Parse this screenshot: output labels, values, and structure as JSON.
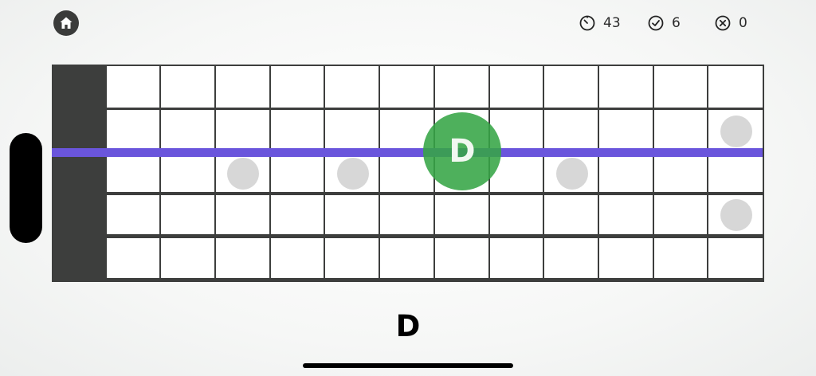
{
  "header": {
    "home_icon": "home-icon",
    "stats": [
      {
        "name": "timer",
        "icon": "timer-icon",
        "value": "43"
      },
      {
        "name": "correct",
        "icon": "check-circle-icon",
        "value": "6"
      },
      {
        "name": "wrong",
        "icon": "x-circle-icon",
        "value": "0"
      }
    ]
  },
  "fretboard": {
    "frets": 12,
    "strings": 6,
    "highlighted_string": 3,
    "colors": {
      "nut": "#3d3e3d",
      "highlight_string": "#6a55dc",
      "target_note": "#36a546",
      "inlay": "#d7d7d7"
    },
    "target": {
      "label": "D",
      "fret": 7,
      "string": 3
    }
  },
  "prompt": {
    "note": "D"
  }
}
